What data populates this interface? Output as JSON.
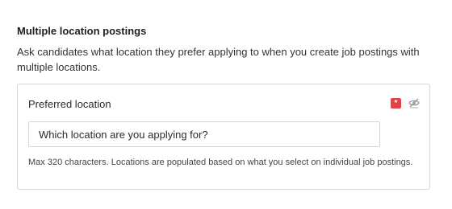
{
  "section": {
    "title": "Multiple location postings",
    "description": "Ask candidates what location they prefer applying to when you create job postings with multiple locations."
  },
  "question": {
    "label": "Preferred location",
    "required_icon": "asterisk-icon",
    "required_color": "#e0444b",
    "visibility_icon": "eye-slash-icon",
    "input_value": "Which location are you applying for?",
    "help_text": "Max 320 characters. Locations are populated based on what you select on individual job postings."
  }
}
